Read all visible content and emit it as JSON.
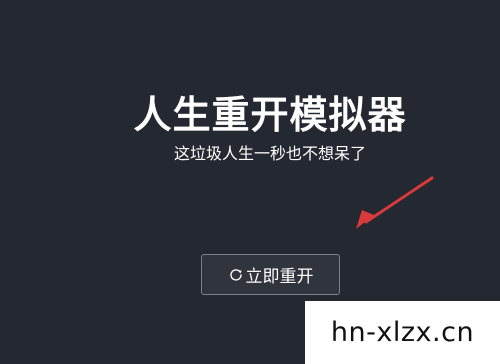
{
  "app": {
    "title": "人生重开模拟器",
    "subtitle": "这垃圾人生一秒也不想呆了"
  },
  "restart_button": {
    "icon": "refresh-icon",
    "label": "立即重开"
  },
  "annotation": {
    "arrow_color": "#d93a3a"
  },
  "watermark": {
    "text": "hn-xlzx.cn"
  },
  "colors": {
    "background": "#232831",
    "text": "#ffffff",
    "button_bg": "#2f343d",
    "button_border": "#7c8088"
  }
}
